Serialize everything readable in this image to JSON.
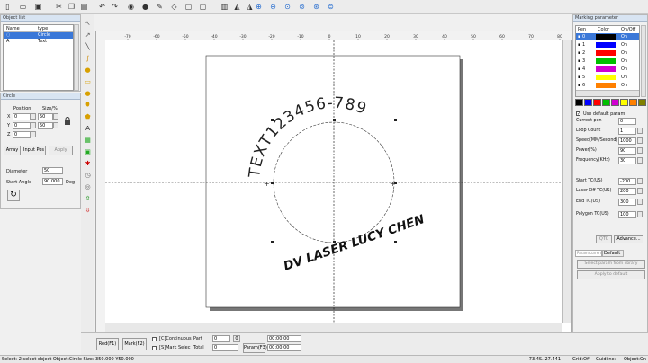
{
  "toolbar": {
    "icons": [
      "new-icon",
      "open-icon",
      "save-icon",
      "cut-icon",
      "copy-icon",
      "paste-icon",
      "undo-icon",
      "redo-icon",
      "select-icon",
      "mark-icon",
      "pen-icon",
      "node-icon",
      "lock-icon",
      "unlock-icon",
      "align-icon",
      "mirror-icon",
      "flip-icon",
      "zoom-in-icon",
      "zoom-out-icon",
      "zoom-fit-icon",
      "zoom-all-icon",
      "zoom-page-icon",
      "zoom-select-icon"
    ]
  },
  "object_list": {
    "title": "Object list",
    "col_name": "Name",
    "col_type": "type",
    "rows": [
      {
        "name": "◌",
        "type": "Circle"
      },
      {
        "name": "A",
        "type": "Text"
      }
    ]
  },
  "circle_panel": {
    "title": "Circle",
    "position_label": "Position",
    "size_label": "Size/%",
    "x_label": "X",
    "x_pos": "0",
    "x_size": "50",
    "y_label": "Y",
    "y_pos": "0",
    "y_size": "50",
    "z_label": "Z",
    "z_pos": "0",
    "array_btn": "Array",
    "input_pos_btn": "Input Pos",
    "apply_btn": "Apply",
    "diameter_label": "Diameter",
    "diameter_value": "50",
    "start_angle_label": "Start Angle",
    "start_angle_value": "90.000",
    "start_angle_unit": "Deg"
  },
  "canvas": {
    "ruler_labels": [
      "-70",
      "-60",
      "-50",
      "-40",
      "-30",
      "-20",
      "-10",
      "0",
      "10",
      "20",
      "30",
      "40",
      "50",
      "60",
      "70",
      "80"
    ],
    "arc_text": "TEXT123456-789",
    "line_text": "DV LASER  LUCY CHEN"
  },
  "marking": {
    "title": "Marking parameter",
    "headers": [
      "Pen",
      "Color",
      "On/Off"
    ],
    "pens": [
      {
        "no": "0",
        "color": "#000000",
        "state": "On"
      },
      {
        "no": "1",
        "color": "#0000ff",
        "state": "On"
      },
      {
        "no": "2",
        "color": "#ff0000",
        "state": "On"
      },
      {
        "no": "3",
        "color": "#00c000",
        "state": "On"
      },
      {
        "no": "4",
        "color": "#d000d0",
        "state": "On"
      },
      {
        "no": "5",
        "color": "#ffff00",
        "state": "On"
      },
      {
        "no": "6",
        "color": "#ff8000",
        "state": "On"
      }
    ],
    "palette": [
      "#000000",
      "#0000ff",
      "#ff0000",
      "#00c000",
      "#d000d0",
      "#ffff00",
      "#ff8000",
      "#808000"
    ],
    "use_default_label": "Use default param",
    "params": [
      {
        "label": "Current pen",
        "value": "0"
      },
      {
        "label": "Loop Count",
        "value": "1"
      },
      {
        "label": "Speed(MM/Second)",
        "value": "1000"
      },
      {
        "label": "Power(%)",
        "value": "90"
      },
      {
        "label": "Frequency(KHz)",
        "value": "30"
      },
      {
        "label": "Start TC(US)",
        "value": "-200"
      },
      {
        "label": "Laser Off TC(US)",
        "value": "200"
      },
      {
        "label": "End TC(US)",
        "value": "300"
      },
      {
        "label": "Polygon TC(US)",
        "value": "100"
      }
    ],
    "qtc_btn": "QTC",
    "advance_btn": "Advance...",
    "tabs": [
      "Param current",
      "Default"
    ],
    "select_param_btn": "Select param from library",
    "apply_default_btn": "Apply to default"
  },
  "bottom": {
    "red_btn": "Red(F1)",
    "mark_btn": "Mark(F2)",
    "continuous_label": "[C]Continuous",
    "part_label": "Part",
    "part_value": "0",
    "selected_mark_label": "[S]Mark Selec",
    "total_label": "Total",
    "total_value": "0",
    "param_btn": "Param(F3)",
    "time1": "00:00:00",
    "time2": "00:00:00"
  },
  "status": {
    "message": "Select: 2 select object Object:Circle Size: 350.000 Y50.000",
    "coords": "-73.4S.-27.441",
    "grid": "Grid:Off",
    "guidline": "Guidline:",
    "object": "Object:On"
  }
}
